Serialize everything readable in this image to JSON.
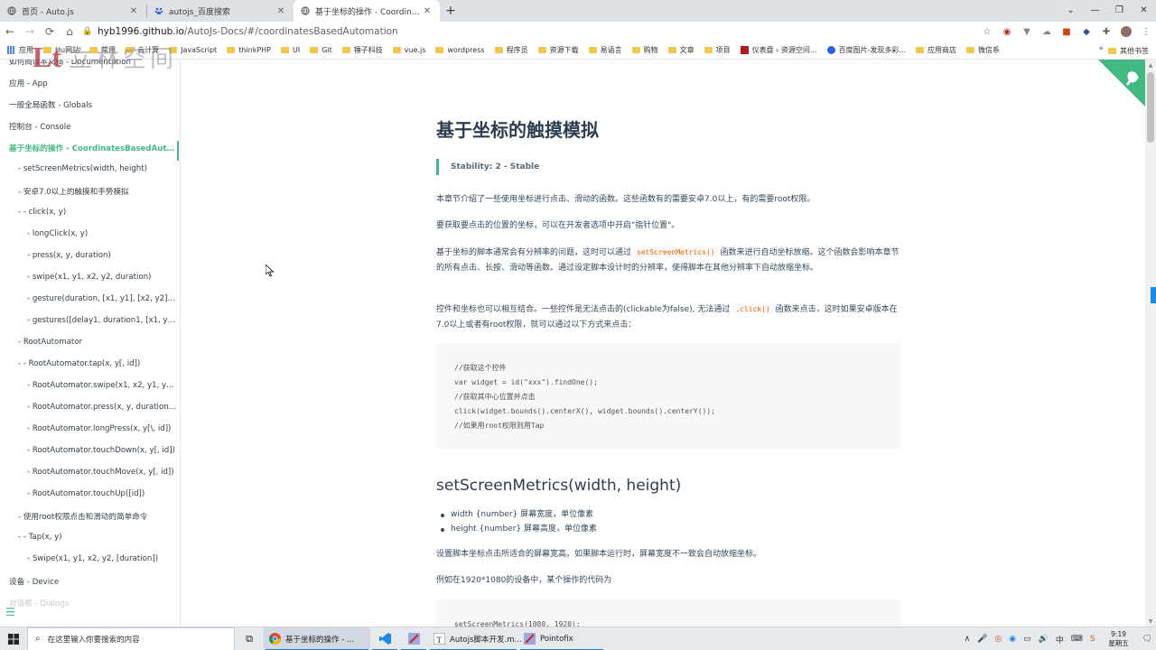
{
  "browser": {
    "tabs": [
      {
        "title": "首页 - Auto.js",
        "active": false
      },
      {
        "title": "autojs_百度搜索",
        "active": false
      },
      {
        "title": "基于坐标的操作 - CoordinatesBasedAutomation",
        "active": true
      }
    ],
    "new_tab_label": "+",
    "url_host": "hyb1996.github.io",
    "url_path": "/AutoJs-Docs/#/coordinatesBasedAutomation",
    "window_controls": {
      "collapse": "⌄",
      "minimize": "—",
      "maximize": "❐",
      "close": "✕"
    }
  },
  "bookmarks": {
    "items": [
      "应用",
      "Hu网站",
      "常用",
      "云计算",
      "JavaScript",
      "thinkPHP",
      "UI",
      "Git",
      "锤子科技",
      "vue.js",
      "wordpress",
      "程序员",
      "资源下载",
      "易语言",
      "购物",
      "文章",
      "项目",
      "仪表盘 ‹ 资源空间...",
      "百度图片-发现多彩...",
      "应用商店",
      "微信系"
    ],
    "more": "»",
    "other": "其他书签"
  },
  "watermark": {
    "text": "Lt 立林空间",
    "color": "#b84550"
  },
  "sidebar": {
    "items": [
      {
        "label": "如何阅读本文档 - Documentation",
        "indent": 0
      },
      {
        "label": "应用 - App",
        "indent": 0
      },
      {
        "label": "一般全局函数 - Globals",
        "indent": 0
      },
      {
        "label": "控制台 - Console",
        "indent": 0
      },
      {
        "label": "基于坐标的操作 - CoordinatesBasedAutoma...",
        "indent": 0,
        "active": true
      },
      {
        "label": "- setScreenMetrics(width, height)",
        "indent": 1
      },
      {
        "label": "- 安卓7.0以上的触摸和手势模拟",
        "indent": 1
      },
      {
        "label": "- - click(x, y)",
        "indent": 1
      },
      {
        "label": "- longClick(x, y)",
        "indent": 2
      },
      {
        "label": "- press(x, y, duration)",
        "indent": 2
      },
      {
        "label": "- swipe(x1, y1, x2, y2, duration)",
        "indent": 2
      },
      {
        "label": "- gesture(duration, [x1, y1], [x2, y2], ...)",
        "indent": 2
      },
      {
        "label": "- gestures([delay1, duration1, [x1, y1], [x...",
        "indent": 2
      },
      {
        "label": "- RootAutomator",
        "indent": 1
      },
      {
        "label": "- - RootAutomator.tap(x, y[, id])",
        "indent": 1
      },
      {
        "label": "- RootAutomator.swipe(x1, x2, y1, y2[, d...",
        "indent": 2
      },
      {
        "label": "- RootAutomator.press(x, y, duration[, id])",
        "indent": 2
      },
      {
        "label": "- RootAutomator.longPress(x, y[\\, id])",
        "indent": 2
      },
      {
        "label": "- RootAutomator.touchDown(x, y[, id])",
        "indent": 2
      },
      {
        "label": "- RootAutomator.touchMove(x, y[, id])",
        "indent": 2
      },
      {
        "label": "- RootAutomator.touchUp([id])",
        "indent": 2
      },
      {
        "label": "- 使用root权限点击和滑动的简单命令",
        "indent": 1
      },
      {
        "label": "- - Tap(x, y)",
        "indent": 1
      },
      {
        "label": "- Swipe(x1, y1, x2, y2, [duration])",
        "indent": 2
      },
      {
        "label": "设备 - Device",
        "indent": 0
      },
      {
        "label": "对话框 - Dialogs",
        "indent": 0,
        "faded": true
      }
    ],
    "menu_icon": "☰"
  },
  "article": {
    "title": "基于坐标的触摸模拟",
    "stability": "Stability: 2 - Stable",
    "para1": "本章节介绍了一些使用坐标进行点击、滑动的函数。这些函数有的需要安卓7.0以上，有的需要root权限。",
    "para2": "要获取要点击的位置的坐标，可以在开发者选项中开启\"指针位置\"。",
    "para3_a": "基于坐标的脚本通常会有分辨率的问题，这时可以通过 ",
    "para3_code": "setScreenMetrics()",
    "para3_b": " 函数来进行自动坐标放缩。这个函数会影响本章节的所有点击、长按、滑动等函数。通过设定脚本设计时的分辨率，使得脚本在其他分辨率下自动放缩坐标。",
    "para4_a": "控件和坐标也可以相互结合。一些控件是无法点击的(clickable为false), 无法通过 ",
    "para4_code": ".click()",
    "para4_b": " 函数来点击，这时如果安卓版本在7.0以上或者有root权限，就可以通过以下方式来点击：",
    "code1": [
      "//获取这个控件",
      "var widget = id(\"xxx\").findOne();",
      "//获取其中心位置并点击",
      "click(widget.bounds().centerX(), widget.bounds().centerY());",
      "//如果用root权限则用Tap"
    ],
    "h2": "setScreenMetrics(width, height)",
    "list": [
      "width {number} 屏幕宽度，单位像素",
      "height {number} 屏幕高度，单位像素"
    ],
    "para5": "设置脚本坐标点击所适合的屏幕宽高。如果脚本运行时，屏幕宽度不一致会自动放缩坐标。",
    "para6": "例如在1920*1080的设备中，某个操作的代码为",
    "code2": [
      "setScreenMetrics(1080, 1920);"
    ]
  },
  "taskbar": {
    "search_placeholder": "在这里输入你要搜索的内容",
    "apps": [
      {
        "label": "基于坐标的操作 - ...",
        "icon": "chrome-icon",
        "focus": true
      },
      {
        "label": "",
        "icon": "vscode-icon",
        "focus": false
      },
      {
        "label": "",
        "icon": "pointofix-app-icon",
        "focus": false
      },
      {
        "label": "Autojs脚本开发.m...",
        "icon": "typora-icon",
        "focus": false
      },
      {
        "label": "Pointofix",
        "icon": "pointofix-icon",
        "focus": false
      }
    ],
    "time": "9:19",
    "day": "星期五"
  },
  "colors": {
    "accent": "#42b983",
    "heading": "#2c3e50",
    "inline_code": "#e96900"
  }
}
